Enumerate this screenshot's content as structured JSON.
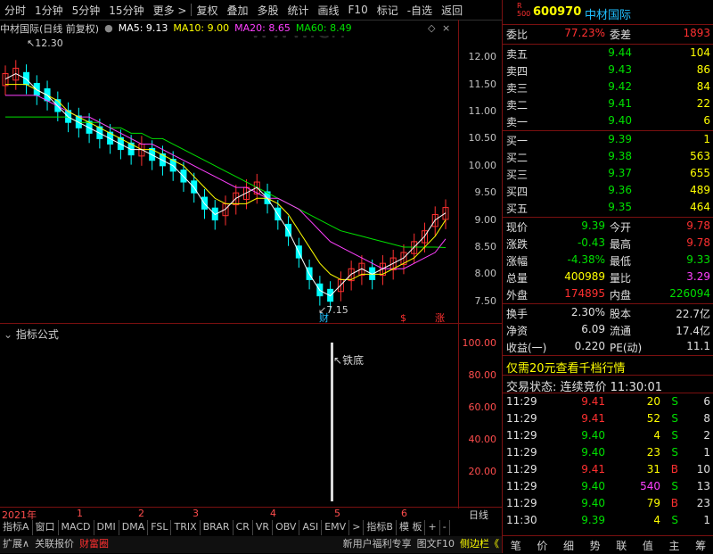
{
  "toolbar": {
    "items": [
      "分时",
      "1分钟",
      "5分钟",
      "15分钟",
      "更多 >",
      "复权",
      "叠加",
      "多股",
      "统计",
      "画线",
      "F10",
      "标记",
      "-自选",
      "返回"
    ]
  },
  "chart_info": {
    "name": "中材国际(日线 前复权)",
    "ma5": "MA5: 9.13",
    "ma10": "MA10: 9.00",
    "ma20": "MA20: 8.65",
    "ma60": "MA60: 8.49",
    "high_label": "12.30",
    "low_label": "7.15",
    "watermark": "www.cn"
  },
  "colors": {
    "ma5": "#ffffff",
    "ma10": "#ffff00",
    "ma20": "#ff40ff",
    "ma60": "#00e000",
    "up": "#ff3030",
    "down": "#00ffff"
  },
  "chart_data": {
    "type": "line",
    "y_ticks": [
      "12.00",
      "11.50",
      "11.00",
      "10.50",
      "10.00",
      "9.50",
      "9.00",
      "8.50",
      "8.00",
      "7.50"
    ],
    "ylim": [
      7.1,
      12.4
    ],
    "ma5": [
      11.6,
      11.7,
      11.6,
      11.4,
      11.3,
      11.1,
      10.9,
      10.8,
      10.7,
      10.6,
      10.5,
      10.4,
      10.3,
      10.3,
      10.2,
      10.1,
      10.0,
      9.8,
      9.6,
      9.3,
      9.1,
      9.2,
      9.4,
      9.5,
      9.6,
      9.4,
      9.1,
      8.8,
      8.4,
      8.0,
      7.7,
      7.6,
      7.8,
      8.0,
      8.1,
      8.0,
      8.1,
      8.2,
      8.3,
      8.5,
      8.7,
      9.0,
      9.13
    ],
    "ma10": [
      11.5,
      11.5,
      11.5,
      11.4,
      11.3,
      11.2,
      11.0,
      10.9,
      10.8,
      10.7,
      10.6,
      10.5,
      10.4,
      10.3,
      10.3,
      10.2,
      10.1,
      10.0,
      9.8,
      9.6,
      9.4,
      9.3,
      9.3,
      9.3,
      9.4,
      9.4,
      9.3,
      9.1,
      8.8,
      8.5,
      8.2,
      8.0,
      7.9,
      7.9,
      8.0,
      8.0,
      8.0,
      8.1,
      8.2,
      8.3,
      8.5,
      8.7,
      9.0
    ],
    "ma20": [
      11.3,
      11.3,
      11.3,
      11.3,
      11.2,
      11.1,
      11.0,
      10.9,
      10.9,
      10.8,
      10.7,
      10.6,
      10.5,
      10.4,
      10.4,
      10.3,
      10.2,
      10.1,
      10.0,
      9.9,
      9.8,
      9.7,
      9.6,
      9.6,
      9.5,
      9.4,
      9.4,
      9.3,
      9.2,
      9.0,
      8.8,
      8.6,
      8.5,
      8.4,
      8.3,
      8.2,
      8.1,
      8.1,
      8.1,
      8.2,
      8.3,
      8.4,
      8.65
    ],
    "ma60": [
      10.9,
      10.9,
      10.9,
      10.9,
      10.9,
      10.9,
      10.9,
      10.8,
      10.8,
      10.8,
      10.7,
      10.7,
      10.6,
      10.6,
      10.5,
      10.5,
      10.4,
      10.3,
      10.2,
      10.1,
      10.0,
      9.9,
      9.8,
      9.7,
      9.6,
      9.5,
      9.4,
      9.3,
      9.2,
      9.1,
      9.0,
      8.9,
      8.8,
      8.75,
      8.7,
      8.65,
      8.6,
      8.55,
      8.5,
      8.5,
      8.5,
      8.5,
      8.49
    ]
  },
  "markers": {
    "cai": "财",
    "s": "$",
    "zhang": "涨"
  },
  "sub_panel": {
    "title": "指标公式",
    "label": "铁底",
    "ticks": [
      "100.00",
      "80.00",
      "60.00",
      "40.00",
      "20.00"
    ]
  },
  "x_axis": {
    "year": "2021年",
    "months": [
      "1",
      "2",
      "3",
      "4",
      "5",
      "6"
    ],
    "period": "日线"
  },
  "tabs_row1": [
    "指标A",
    "窗口",
    "MACD",
    "DMI",
    "DMA",
    "FSL",
    "TRIX",
    "BRAR",
    "CR",
    "VR",
    "OBV",
    "ASI",
    "EMV",
    ">",
    "指标B",
    "模 板",
    "+",
    "-"
  ],
  "tabs_row2": {
    "left": [
      "扩展∧",
      "关联报价",
      "财富圈"
    ],
    "right": [
      "新用户福利专享",
      "图文F10",
      "侧边栏《"
    ]
  },
  "quote": {
    "code": "600970",
    "name": "中材国际",
    "weibi_label": "委比",
    "weibi": "77.23%",
    "weicha_label": "委差",
    "weicha": "1893",
    "asks": [
      {
        "label": "卖五",
        "price": "9.44",
        "vol": "104"
      },
      {
        "label": "卖四",
        "price": "9.43",
        "vol": "86"
      },
      {
        "label": "卖三",
        "price": "9.42",
        "vol": "84"
      },
      {
        "label": "卖二",
        "price": "9.41",
        "vol": "22"
      },
      {
        "label": "卖一",
        "price": "9.40",
        "vol": "6"
      }
    ],
    "bids": [
      {
        "label": "买一",
        "price": "9.39",
        "vol": "1"
      },
      {
        "label": "买二",
        "price": "9.38",
        "vol": "563"
      },
      {
        "label": "买三",
        "price": "9.37",
        "vol": "655"
      },
      {
        "label": "买四",
        "price": "9.36",
        "vol": "489"
      },
      {
        "label": "买五",
        "price": "9.35",
        "vol": "464"
      }
    ],
    "stats": [
      {
        "l1": "现价",
        "v1": "9.39",
        "c1": "green",
        "l2": "今开",
        "v2": "9.78",
        "c2": "red"
      },
      {
        "l1": "涨跌",
        "v1": "-0.43",
        "c1": "green",
        "l2": "最高",
        "v2": "9.78",
        "c2": "red"
      },
      {
        "l1": "涨幅",
        "v1": "-4.38%",
        "c1": "green",
        "l2": "最低",
        "v2": "9.33",
        "c2": "green"
      },
      {
        "l1": "总量",
        "v1": "400989",
        "c1": "yellow",
        "l2": "量比",
        "v2": "3.29",
        "c2": "magenta"
      },
      {
        "l1": "外盘",
        "v1": "174895",
        "c1": "red",
        "l2": "内盘",
        "v2": "226094",
        "c2": "green"
      }
    ],
    "stats2": [
      {
        "l1": "换手",
        "v1": "2.30%",
        "l2": "股本",
        "v2": "22.7亿"
      },
      {
        "l1": "净资",
        "v1": "6.09",
        "l2": "流通",
        "v2": "17.4亿"
      },
      {
        "l1": "收益(一)",
        "v1": "0.220",
        "l2": "PE(动)",
        "v2": "11.1"
      }
    ],
    "promo": "仅需20元查看千档行情",
    "status": "交易状态: 连续竞价 11:30:01",
    "trades": [
      {
        "t": "11:29",
        "p": "9.41",
        "v": "20",
        "d": "S",
        "n": "6",
        "pc": "red",
        "vc": "yellow",
        "dc": "green"
      },
      {
        "t": "11:29",
        "p": "9.41",
        "v": "52",
        "d": "S",
        "n": "8",
        "pc": "red",
        "vc": "yellow",
        "dc": "green"
      },
      {
        "t": "11:29",
        "p": "9.40",
        "v": "4",
        "d": "S",
        "n": "2",
        "pc": "green",
        "vc": "yellow",
        "dc": "green"
      },
      {
        "t": "11:29",
        "p": "9.40",
        "v": "23",
        "d": "S",
        "n": "1",
        "pc": "green",
        "vc": "yellow",
        "dc": "green"
      },
      {
        "t": "11:29",
        "p": "9.41",
        "v": "31",
        "d": "B",
        "n": "10",
        "pc": "red",
        "vc": "yellow",
        "dc": "red"
      },
      {
        "t": "11:29",
        "p": "9.40",
        "v": "540",
        "d": "S",
        "n": "13",
        "pc": "green",
        "vc": "magenta",
        "dc": "green"
      },
      {
        "t": "11:29",
        "p": "9.40",
        "v": "79",
        "d": "B",
        "n": "23",
        "pc": "green",
        "vc": "yellow",
        "dc": "red"
      },
      {
        "t": "11:30",
        "p": "9.39",
        "v": "4",
        "d": "S",
        "n": "1",
        "pc": "green",
        "vc": "yellow",
        "dc": "green"
      }
    ],
    "nav": [
      "笔",
      "价",
      "细",
      "势",
      "联",
      "值",
      "主",
      "筹"
    ]
  }
}
